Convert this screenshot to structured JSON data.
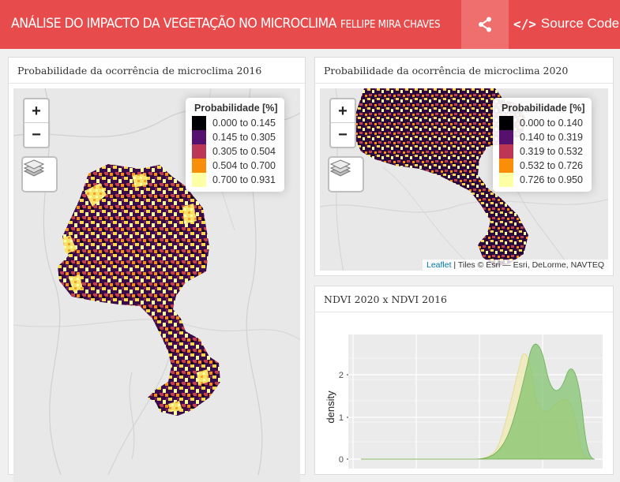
{
  "navbar": {
    "title": "ANÁLISE DO IMPACTO DA VEGETAÇÃO NO MICROCLIMA",
    "author": "FELLIPE MIRA CHAVES",
    "share_icon": "share-icon",
    "source_label": "Source Code",
    "source_glyph": "</>",
    "bg_color": "#e84b4b"
  },
  "map2016": {
    "title": "Probabilidade da ocorrência de microclima 2016",
    "zoom_in": "+",
    "zoom_out": "−",
    "legend": {
      "title": "Probabilidade [%]",
      "items": [
        {
          "label": "0.000 to 0.145",
          "color": "#000004"
        },
        {
          "label": "0.145 to 0.305",
          "color": "#56106e"
        },
        {
          "label": "0.305 to 0.504",
          "color": "#bb3754"
        },
        {
          "label": "0.504 to 0.700",
          "color": "#f98e09"
        },
        {
          "label": "0.700 to 0.931",
          "color": "#fcffa4"
        }
      ]
    }
  },
  "map2020": {
    "title": "Probabilidade da ocorrência de microclima 2020",
    "zoom_in": "+",
    "zoom_out": "−",
    "legend": {
      "title": "Probabilidade [%]",
      "items": [
        {
          "label": "0.000 to 0.140",
          "color": "#000004"
        },
        {
          "label": "0.140 to 0.319",
          "color": "#56106e"
        },
        {
          "label": "0.319 to 0.532",
          "color": "#bb3754"
        },
        {
          "label": "0.532 to 0.726",
          "color": "#f98e09"
        },
        {
          "label": "0.726 to 0.950",
          "color": "#fcffa4"
        }
      ]
    },
    "attribution": {
      "leaflet": "Leaflet",
      "rest": " | Tiles © Esri — Esri, DeLorme, NAVTEQ"
    }
  },
  "density": {
    "title": "NDVI 2020 x NDVI 2016",
    "chart_data": {
      "type": "area",
      "ylabel": "density",
      "yticks": [
        "0",
        "1",
        "2"
      ],
      "series": [
        {
          "color": "#f0e9b0"
        },
        {
          "color": "#7fc26b"
        }
      ]
    }
  }
}
